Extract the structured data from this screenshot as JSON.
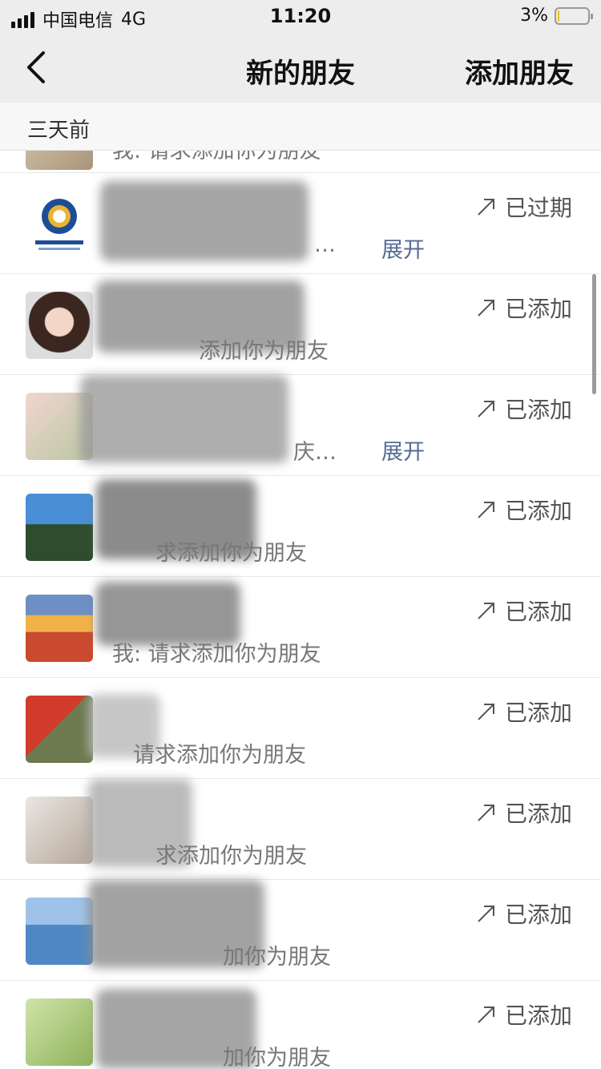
{
  "status_bar": {
    "carrier": "中国电信",
    "network": "4G",
    "time": "11:20",
    "battery_percent": "3%",
    "battery_level": 0.03
  },
  "nav": {
    "title": "新的朋友",
    "action": "添加朋友"
  },
  "section": {
    "label": "三天前"
  },
  "partial_row": {
    "message": "我: 请求添加你为朋友"
  },
  "rows": [
    {
      "message": "…",
      "expand": "展开",
      "status": "已过期"
    },
    {
      "message": "添加你为朋友",
      "status": "已添加"
    },
    {
      "message": "庆…",
      "expand": "展开",
      "status": "已添加"
    },
    {
      "message": "求添加你为朋友",
      "status": "已添加"
    },
    {
      "message": "我: 请求添加你为朋友",
      "status": "已添加"
    },
    {
      "message": "请求添加你为朋友",
      "status": "已添加"
    },
    {
      "message": "求添加你为朋友",
      "status": "已添加"
    },
    {
      "message": "加你为朋友",
      "status": "已添加"
    },
    {
      "message": "加你为朋友",
      "status": "已添加"
    }
  ]
}
